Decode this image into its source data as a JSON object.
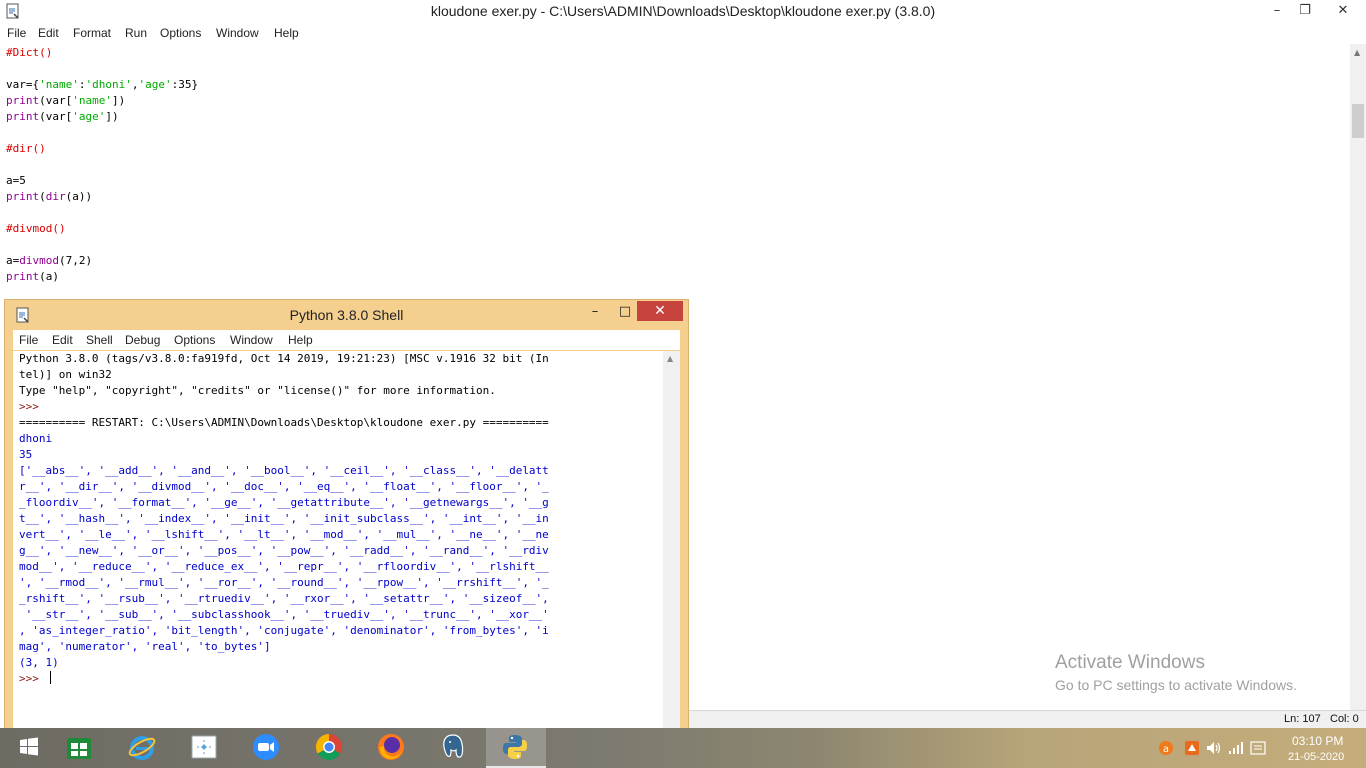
{
  "editor": {
    "title": "kloudone exer.py - C:\\Users\\ADMIN\\Downloads\\Desktop\\kloudone exer.py (3.8.0)",
    "menu": [
      "File",
      "Edit",
      "Format",
      "Run",
      "Options",
      "Window",
      "Help"
    ],
    "code": {
      "l1": "#Dict()",
      "l3a": "var={",
      "l3b": "'name'",
      "l3c": ":",
      "l3d": "'dhoni'",
      "l3e": ",",
      "l3f": "'age'",
      "l3g": ":35}",
      "l4a": "print",
      "l4b": "(var[",
      "l4c": "'name'",
      "l4d": "])",
      "l5a": "print",
      "l5b": "(var[",
      "l5c": "'age'",
      "l5d": "])",
      "l7": "#dir()",
      "l9": "a=5",
      "l10a": "print",
      "l10b": "(",
      "l10c": "dir",
      "l10d": "(a))",
      "l12": "#divmod()",
      "l14a": "a=",
      "l14b": "divmod",
      "l14c": "(7,2)",
      "l15a": "print",
      "l15b": "(a)"
    },
    "status": {
      "line": "Ln: 107",
      "col": "Col: 0"
    }
  },
  "shell": {
    "title": "Python 3.8.0 Shell",
    "menu": [
      "File",
      "Edit",
      "Shell",
      "Debug",
      "Options",
      "Window",
      "Help"
    ],
    "lines": [
      "Python 3.8.0 (tags/v3.8.0:fa919fd, Oct 14 2019, 19:21:23) [MSC v.1916 32 bit (In",
      "tel)] on win32",
      "Type \"help\", \"copyright\", \"credits\" or \"license()\" for more information.",
      ">>> ",
      "========== RESTART: C:\\Users\\ADMIN\\Downloads\\Desktop\\kloudone exer.py ==========",
      "dhoni",
      "35",
      "['__abs__', '__add__', '__and__', '__bool__', '__ceil__', '__class__', '__delatt",
      "r__', '__dir__', '__divmod__', '__doc__', '__eq__', '__float__', '__floor__', '_",
      "_floordiv__', '__format__', '__ge__', '__getattribute__', '__getnewargs__', '__g",
      "t__', '__hash__', '__index__', '__init__', '__init_subclass__', '__int__', '__in",
      "vert__', '__le__', '__lshift__', '__lt__', '__mod__', '__mul__', '__ne__', '__ne",
      "g__', '__new__', '__or__', '__pos__', '__pow__', '__radd__', '__rand__', '__rdiv",
      "mod__', '__reduce__', '__reduce_ex__', '__repr__', '__rfloordiv__', '__rlshift__",
      "', '__rmod__', '__rmul__', '__ror__', '__round__', '__rpow__', '__rrshift__', '_",
      "_rshift__', '__rsub__', '__rtruediv__', '__rxor__', '__setattr__', '__sizeof__',",
      " '__str__', '__sub__', '__subclasshook__', '__truediv__', '__trunc__', '__xor__'",
      ", 'as_integer_ratio', 'bit_length', 'conjugate', 'denominator', 'from_bytes', 'i",
      "mag', 'numerator', 'real', 'to_bytes']",
      "(3, 1)",
      ">>> "
    ]
  },
  "watermark": {
    "title": "Activate Windows",
    "subtitle": "Go to PC settings to activate Windows."
  },
  "taskbar": {
    "time": "03:10 PM",
    "date": "21-05-2020"
  }
}
